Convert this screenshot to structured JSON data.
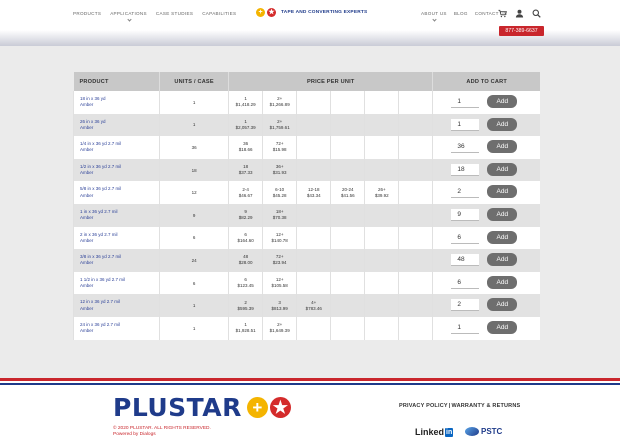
{
  "nav": {
    "left": [
      "PRODUCTS",
      "APPLICATIONS",
      "CASE STUDIES",
      "CAPABILITIES"
    ],
    "tagline": "TAPE AND CONVERTING EXPERTS",
    "right": [
      "ABOUT US",
      "BLOG",
      "CONTACT US"
    ],
    "icons": [
      "cart-icon",
      "user-icon",
      "search-icon"
    ],
    "phone": "877-389-6637"
  },
  "table": {
    "headers": [
      "PRODUCT",
      "UNITS / CASE",
      "PRICE PER UNIT",
      "ADD TO CART"
    ],
    "add_label": "Add",
    "rows": [
      {
        "name": "18 in x 36 yd",
        "color": "Amber",
        "units": "1",
        "prices": [
          [
            "1",
            "$1,418.29"
          ],
          [
            "2+",
            "$1,266.89"
          ]
        ],
        "qty": "1"
      },
      {
        "name": "26 in x 36 yd",
        "color": "Amber",
        "units": "1",
        "prices": [
          [
            "1",
            "$2,057.39"
          ],
          [
            "2+",
            "$1,759.61"
          ]
        ],
        "qty": "1"
      },
      {
        "name": "1/4 in x 36 yd 2.7 mil",
        "color": "Amber",
        "units": "36",
        "prices": [
          [
            "36",
            "$18.66"
          ],
          [
            "72+",
            "$15.98"
          ]
        ],
        "qty": "36"
      },
      {
        "name": "1/2 in x 36 yd 2.7 mil",
        "color": "Amber",
        "units": "18",
        "prices": [
          [
            "18",
            "$37.33"
          ],
          [
            "36+",
            "$31.93"
          ]
        ],
        "qty": "18"
      },
      {
        "name": "5/8 in x 36 yd 2.7 mil",
        "color": "Amber",
        "units": "12",
        "prices": [
          [
            "2-4",
            "$46.67"
          ],
          [
            "6-10",
            "$45.28"
          ],
          [
            "12-18",
            "$43.34"
          ],
          [
            "20-24",
            "$41.56"
          ],
          [
            "26+",
            "$39.92"
          ]
        ],
        "qty": "2"
      },
      {
        "name": "1 in x 36 yd 2.7 mil",
        "color": "Amber",
        "units": "9",
        "prices": [
          [
            "9",
            "$82.29"
          ],
          [
            "18+",
            "$70.38"
          ]
        ],
        "qty": "9"
      },
      {
        "name": "2 in x 36 yd 2.7 mil",
        "color": "Amber",
        "units": "6",
        "prices": [
          [
            "6",
            "$164.60"
          ],
          [
            "12+",
            "$140.78"
          ]
        ],
        "qty": "6"
      },
      {
        "name": "3/8 in x 36 yd 2.7 mil",
        "color": "Amber",
        "units": "24",
        "prices": [
          [
            "48",
            "$28.00"
          ],
          [
            "72+",
            "$23.94"
          ]
        ],
        "qty": "48"
      },
      {
        "name": "1 1/2 in x 36 yd 2.7 mil",
        "color": "Amber",
        "units": "6",
        "prices": [
          [
            "6",
            "$123.45"
          ],
          [
            "12+",
            "$105.58"
          ]
        ],
        "qty": "6"
      },
      {
        "name": "12 in x 36 yd 2.7 mil",
        "color": "Amber",
        "units": "1",
        "prices": [
          [
            "2",
            "$595.39"
          ],
          [
            "3",
            "$813.99"
          ],
          [
            "4+",
            "$783.46"
          ]
        ],
        "qty": "2"
      },
      {
        "name": "24 in x 36 yd 2.7 mil",
        "color": "Amber",
        "units": "1",
        "prices": [
          [
            "1",
            "$1,928.51"
          ],
          [
            "2+",
            "$1,649.39"
          ]
        ],
        "qty": "1"
      }
    ]
  },
  "footer": {
    "brand": "PLUSTAR",
    "copyright": "© 2020 PLUSTAR. ALL RIGHTS RESERVED.",
    "powered": "Powered by Dialogs",
    "privacy": "PRIVACY POLICY",
    "warranty": "WARRANTY & RETURNS",
    "linkedin": "Linked",
    "linkedin_in": "in",
    "pstc": "PSTC"
  }
}
